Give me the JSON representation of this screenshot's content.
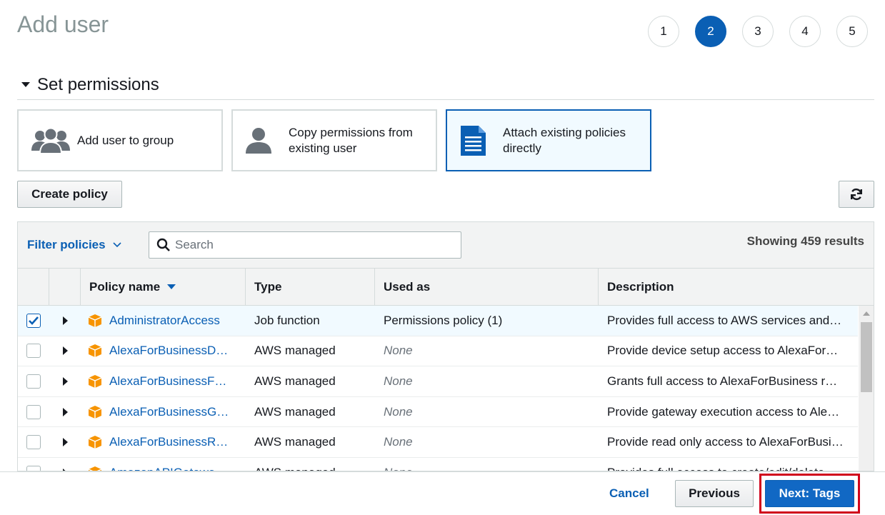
{
  "page": {
    "title": "Add user"
  },
  "steps": [
    "1",
    "2",
    "3",
    "4",
    "5"
  ],
  "active_step": 2,
  "section": {
    "title": "Set permissions"
  },
  "permission_options": [
    {
      "line1": "Add user to group",
      "line2": "",
      "icon": "users-group-icon"
    },
    {
      "line1": "Copy permissions from",
      "line2": "existing user",
      "icon": "user-icon"
    },
    {
      "line1": "Attach existing policies",
      "line2": "directly",
      "icon": "document-icon",
      "selected": true
    }
  ],
  "toolbar": {
    "create_policy": "Create policy",
    "refresh_icon": "refresh-icon",
    "filter_label": "Filter policies",
    "search_placeholder": "Search",
    "results": "Showing 459 results"
  },
  "table": {
    "columns": [
      "Policy name",
      "Type",
      "Used as",
      "Description"
    ],
    "rows": [
      {
        "checked": true,
        "name": "AdministratorAccess",
        "type": "Job function",
        "used_as": "Permissions policy (1)",
        "used_none": false,
        "description": "Provides full access to AWS services and…"
      },
      {
        "checked": false,
        "name": "AlexaForBusinessD…",
        "type": "AWS managed",
        "used_as": "None",
        "used_none": true,
        "description": "Provide device setup access to AlexaFor…"
      },
      {
        "checked": false,
        "name": "AlexaForBusinessF…",
        "type": "AWS managed",
        "used_as": "None",
        "used_none": true,
        "description": "Grants full access to AlexaForBusiness r…"
      },
      {
        "checked": false,
        "name": "AlexaForBusinessG…",
        "type": "AWS managed",
        "used_as": "None",
        "used_none": true,
        "description": "Provide gateway execution access to Ale…"
      },
      {
        "checked": false,
        "name": "AlexaForBusinessR…",
        "type": "AWS managed",
        "used_as": "None",
        "used_none": true,
        "description": "Provide read only access to AlexaForBusi…"
      },
      {
        "checked": false,
        "name": "AmazonAPIGatewa…",
        "type": "AWS managed",
        "used_as": "None",
        "used_none": true,
        "description": "Provides full access to create/edit/delete…"
      }
    ]
  },
  "footer": {
    "cancel": "Cancel",
    "previous": "Previous",
    "next": "Next: Tags"
  },
  "colors": {
    "accent": "#0a5fb4",
    "package": "#f79400",
    "highlight": "#d0021b"
  }
}
